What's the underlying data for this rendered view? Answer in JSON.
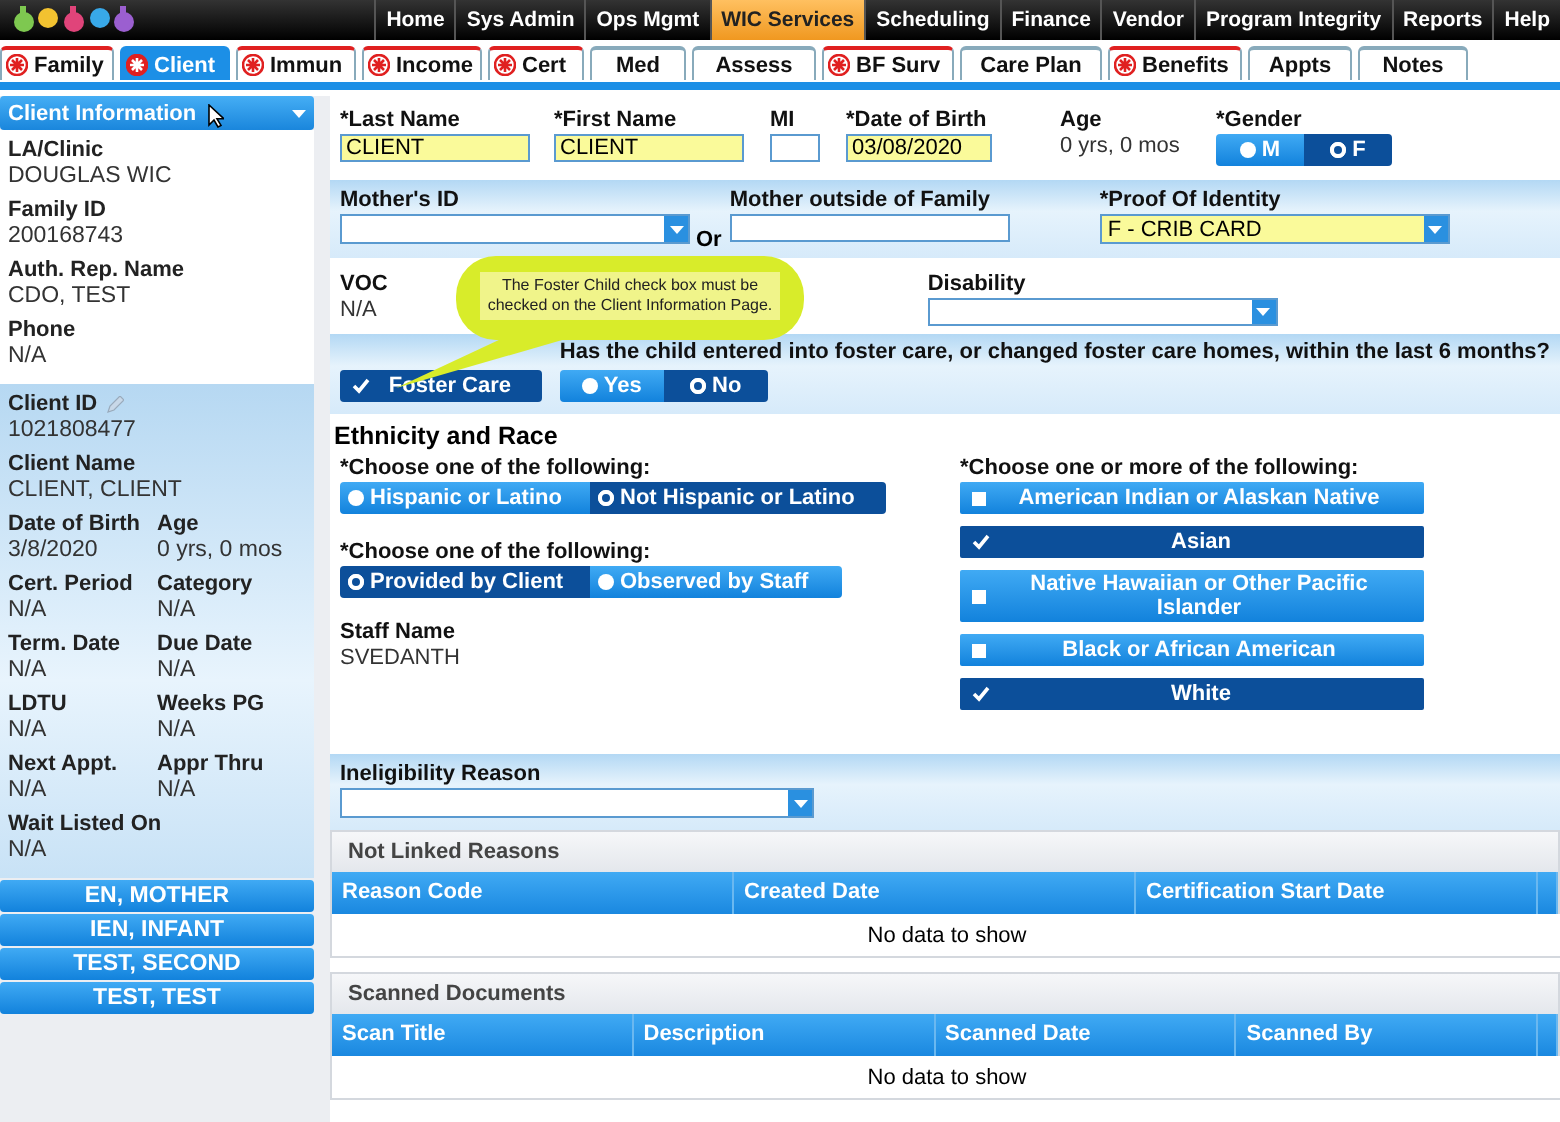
{
  "top_menu": [
    {
      "label": "Home",
      "selected": false
    },
    {
      "label": "Sys Admin",
      "selected": false
    },
    {
      "label": "Ops Mgmt",
      "selected": false
    },
    {
      "label": "WIC Services",
      "selected": true
    },
    {
      "label": "Scheduling",
      "selected": false
    },
    {
      "label": "Finance",
      "selected": false
    },
    {
      "label": "Vendor",
      "selected": false
    },
    {
      "label": "Program Integrity",
      "selected": false
    },
    {
      "label": "Reports",
      "selected": false
    },
    {
      "label": "Help",
      "selected": false
    }
  ],
  "tabs": [
    {
      "label": "Family",
      "selected": false,
      "required": true
    },
    {
      "label": "Client",
      "selected": true,
      "required": true
    },
    {
      "label": "Immun",
      "selected": false,
      "required": true
    },
    {
      "label": "Income",
      "selected": false,
      "required": true
    },
    {
      "label": "Cert",
      "selected": false,
      "required": true
    },
    {
      "label": "Med",
      "selected": false,
      "required": false
    },
    {
      "label": "Assess",
      "selected": false,
      "required": false
    },
    {
      "label": "BF Surv",
      "selected": false,
      "required": true
    },
    {
      "label": "Care Plan",
      "selected": false,
      "required": false
    },
    {
      "label": "Benefits",
      "selected": false,
      "required": true
    },
    {
      "label": "Appts",
      "selected": false,
      "required": false
    },
    {
      "label": "Notes",
      "selected": false,
      "required": false
    }
  ],
  "sidebar": {
    "header": "Client Information",
    "info": [
      {
        "label": "LA/Clinic",
        "value": "DOUGLAS WIC"
      },
      {
        "label": "Family ID",
        "value": "200168743"
      },
      {
        "label": "Auth. Rep. Name",
        "value": "CDO, TEST"
      },
      {
        "label": "Phone",
        "value": "N/A"
      }
    ],
    "details": [
      [
        {
          "label": "Client ID",
          "value": "1021808477"
        }
      ],
      [
        {
          "label": "Client Name",
          "value": "CLIENT, CLIENT"
        }
      ],
      [
        {
          "label": "Date of Birth",
          "value": "3/8/2020"
        },
        {
          "label": "Age",
          "value": "0 yrs, 0 mos"
        }
      ],
      [
        {
          "label": "Cert. Period",
          "value": "N/A"
        },
        {
          "label": "Category",
          "value": "N/A"
        }
      ],
      [
        {
          "label": "Term. Date",
          "value": "N/A"
        },
        {
          "label": "Due Date",
          "value": "N/A"
        }
      ],
      [
        {
          "label": "LDTU",
          "value": "N/A"
        },
        {
          "label": "Weeks PG",
          "value": "N/A"
        }
      ],
      [
        {
          "label": "Next Appt.",
          "value": "N/A"
        },
        {
          "label": "Appr Thru",
          "value": "N/A"
        }
      ],
      [
        {
          "label": "Wait Listed On",
          "value": "N/A"
        }
      ]
    ],
    "family_members": [
      "EN, MOTHER",
      "IEN, INFANT",
      "TEST, SECOND",
      "TEST, TEST"
    ]
  },
  "form": {
    "name_fields": [
      {
        "label": "*Last Name",
        "value": "CLIENT",
        "required": true
      },
      {
        "label": "*First Name",
        "value": "CLIENT",
        "required": true
      },
      {
        "label": "MI",
        "required": false
      },
      {
        "label": "*Date of Birth",
        "value": "03/08/2020",
        "required": true
      }
    ],
    "age": {
      "label": "Age",
      "value": "0 yrs, 0 mos"
    },
    "gender": {
      "label": "*Gender",
      "options": [
        {
          "label": "M",
          "selected": false
        },
        {
          "label": "F",
          "selected": true
        }
      ]
    },
    "mothers_id": {
      "label": "Mother's ID"
    },
    "or": "Or",
    "mother_outside": {
      "label": "Mother outside of Family"
    },
    "proof": {
      "label": "*Proof Of Identity",
      "value": "F - CRIB CARD"
    },
    "voc": {
      "label": "VOC",
      "value": "N/A"
    },
    "disability": {
      "label": "Disability"
    },
    "foster": {
      "label": "Foster Care",
      "checked": true,
      "question": "Has the child entered into foster care, or changed foster care homes, within the last 6 months?",
      "options": [
        {
          "label": "Yes",
          "selected": false
        },
        {
          "label": "No",
          "selected": true
        }
      ]
    },
    "tooltip": "The Foster Child check box must be checked on the Client Information Page.",
    "ethnicity_title": "Ethnicity and Race",
    "ethnicity_prompt": "*Choose one of the following:",
    "ethnicity_options": [
      {
        "label": "Hispanic or Latino",
        "selected": false
      },
      {
        "label": "Not Hispanic or Latino",
        "selected": true
      }
    ],
    "source_prompt": "*Choose one of the following:",
    "source_options": [
      {
        "label": "Provided by Client",
        "selected": true
      },
      {
        "label": "Observed by Staff",
        "selected": false
      }
    ],
    "staff": {
      "label": "Staff Name",
      "value": "SVEDANTH"
    },
    "race_prompt": "*Choose one or more of the following:",
    "races": [
      {
        "label": "American Indian or Alaskan Native",
        "checked": false
      },
      {
        "label": "Asian",
        "checked": true
      },
      {
        "label": "Native Hawaiian or Other Pacific Islander",
        "checked": false
      },
      {
        "label": "Black or African American",
        "checked": false
      },
      {
        "label": "White",
        "checked": true
      }
    ],
    "ineligibility": {
      "label": "Ineligibility Reason"
    }
  },
  "tables": [
    {
      "title": "Not Linked Reasons",
      "columns": [
        "Reason Code",
        "Created Date",
        "Certification Start Date"
      ],
      "empty": "No data to show"
    },
    {
      "title": "Scanned Documents",
      "columns": [
        "Scan Title",
        "Description",
        "Scanned Date",
        "Scanned By"
      ],
      "empty": "No data to show"
    }
  ]
}
